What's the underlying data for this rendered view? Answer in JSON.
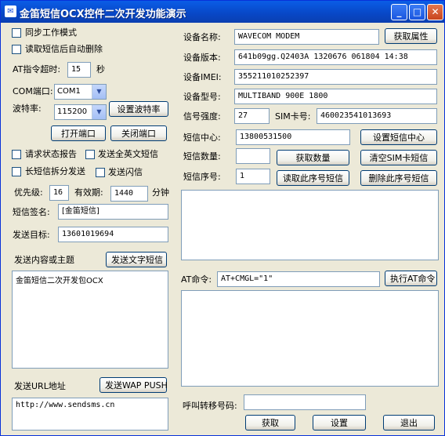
{
  "window": {
    "title": "金笛短信OCX控件二次开发功能演示",
    "minimize": "_",
    "maximize": "□",
    "close": "✕"
  },
  "left": {
    "sync_mode": "同步工作模式",
    "auto_delete": "读取短信后自动删除",
    "at_timeout_label": "AT指令超时:",
    "at_timeout_value": "15",
    "at_timeout_unit": "秒",
    "com_label": "COM端口:",
    "com_value": "COM1",
    "baud_label": "波特率:",
    "baud_value": "115200",
    "set_baud_button": "设置波特率",
    "open_port_button": "打开端口",
    "close_port_button": "关闭端口",
    "request_report": "请求状态报告",
    "send_english": "发送全英文短信",
    "split_long": "长短信拆分发送",
    "send_flash": "发送闪信",
    "priority_label": "优先级:",
    "priority_value": "16",
    "validity_label": "有效期:",
    "validity_value": "1440",
    "validity_unit": "分钟",
    "signature_label": "短信签名:",
    "signature_value": "[金笛短信]",
    "target_label": "发送目标:",
    "target_value": "13601019694",
    "content_label": "发送内容或主题",
    "send_text_button": "发送文字短信",
    "content_value": "金笛短信二次开发包OCX",
    "url_label": "发送URL地址",
    "send_wap_button": "发送WAP PUSH",
    "url_value": "http://www.sendsms.cn"
  },
  "right": {
    "device_name_label": "设备名称:",
    "device_name_value": "WAVECOM MODEM",
    "get_props_button": "获取属性",
    "version_label": "设备版本:",
    "version_value": "641b09gg.Q2403A 1320676 061804 14:38",
    "imei_label": "设备IMEI:",
    "imei_value": "355211010252397",
    "model_label": "设备型号:",
    "model_value": "MULTIBAND  900E  1800",
    "signal_label": "信号强度:",
    "signal_value": "27",
    "sim_label": "SIM卡号:",
    "sim_value": "460023541013693",
    "center_label": "短信中心:",
    "center_value": "13800531500",
    "set_center_button": "设置短信中心",
    "count_label": "短信数量:",
    "count_value": "",
    "get_count_button": "获取数量",
    "clear_sim_button": "清空SIM卡短信",
    "index_label": "短信序号:",
    "index_value": "1",
    "read_index_button": "读取此序号短信",
    "delete_index_button": "删除此序号短信",
    "at_label": "AT命令:",
    "at_value": "AT+CMGL=\"1\"",
    "exec_at_button": "执行AT命令",
    "forward_label": "呼叫转移号码:",
    "forward_value": "",
    "get_button": "获取",
    "set_button": "设置",
    "exit_button": "退出"
  }
}
